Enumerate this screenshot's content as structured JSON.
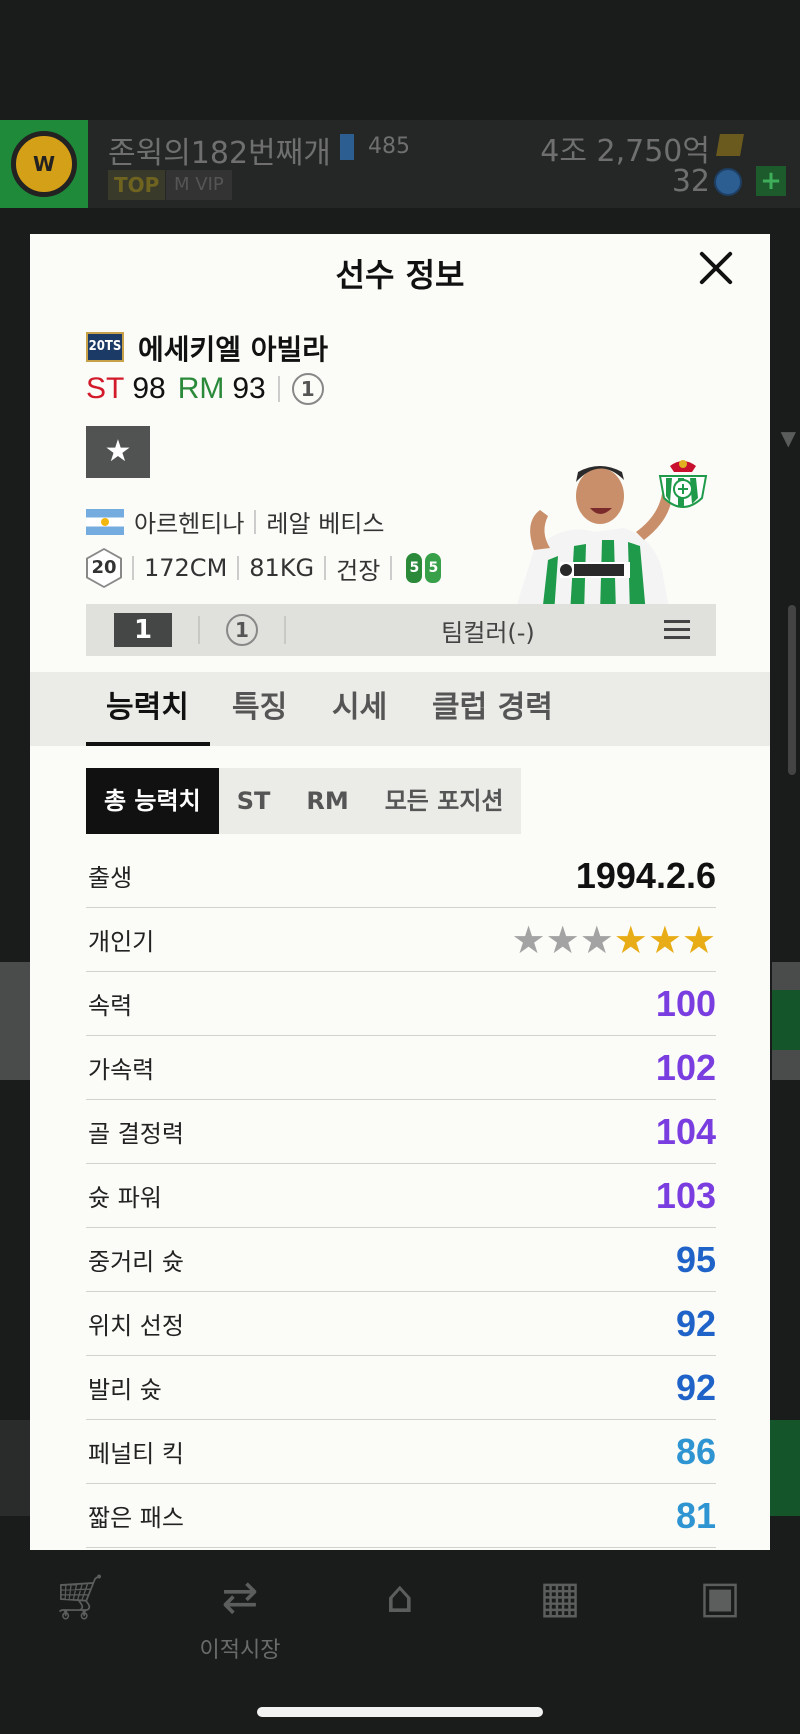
{
  "top_bar": {
    "username": "존윅의182번째개",
    "level": "485",
    "top_badge": "TOP",
    "vip_badge": "M VIP",
    "money": "4조 2,750억",
    "coins": "32",
    "plus": "+"
  },
  "modal": {
    "title": "선수 정보",
    "season_badge": "20TS",
    "player_name": "에세키엘 아빌라",
    "positions": [
      {
        "pos": "ST",
        "ovr": "98"
      },
      {
        "pos": "RM",
        "ovr": "93"
      }
    ],
    "enhance_level": "1",
    "favorite_icon": "star-icon",
    "nation": "아르헨티나",
    "club": "레알 베티스",
    "skill_moves": "20",
    "height": "172CM",
    "weight": "81KG",
    "physique": "건장",
    "foot_left": "5",
    "foot_right": "5",
    "grade": "1",
    "grade_circle": "1",
    "team_color": "팀컬러(-)",
    "tabs": [
      "능력치",
      "특징",
      "시세",
      "클럽 경력"
    ],
    "subtabs": [
      "총 능력치",
      "ST",
      "RM",
      "모든 포지션"
    ],
    "birth_label": "출생",
    "birth_value": "1994.2.6",
    "popularity_label": "개인기",
    "popularity_stars": 3,
    "popularity_max": 6,
    "stats": [
      {
        "label": "속력",
        "value": "100",
        "color": "#7a3ee0"
      },
      {
        "label": "가속력",
        "value": "102",
        "color": "#7a3ee0"
      },
      {
        "label": "골 결정력",
        "value": "104",
        "color": "#7a3ee0"
      },
      {
        "label": "슛 파워",
        "value": "103",
        "color": "#7a3ee0"
      },
      {
        "label": "중거리 슛",
        "value": "95",
        "color": "#1f63c9"
      },
      {
        "label": "위치 선정",
        "value": "92",
        "color": "#1f63c9"
      },
      {
        "label": "발리 슛",
        "value": "92",
        "color": "#1f63c9"
      },
      {
        "label": "페널티 킥",
        "value": "86",
        "color": "#2f95d2"
      },
      {
        "label": "짧은 패스",
        "value": "81",
        "color": "#2f95d2"
      }
    ]
  },
  "bottom_nav": {
    "items": [
      {
        "icon": "cart-icon",
        "label": ""
      },
      {
        "icon": "transfer-icon",
        "label": "이적시장"
      },
      {
        "icon": "home-icon",
        "label": ""
      },
      {
        "icon": "squad-icon",
        "label": ""
      },
      {
        "icon": "briefcase-icon",
        "label": ""
      }
    ]
  }
}
